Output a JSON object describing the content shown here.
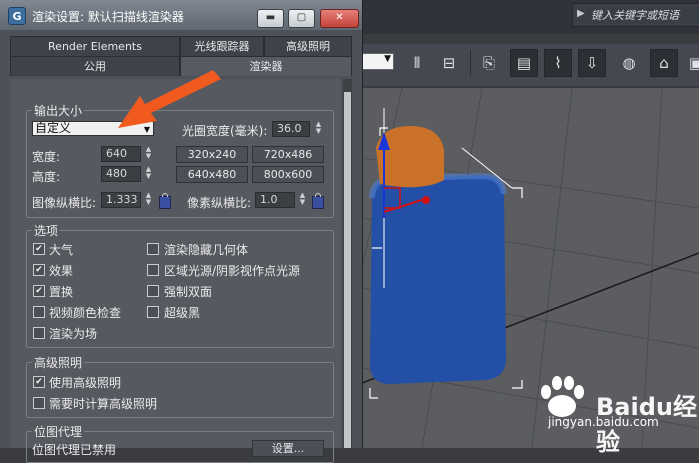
{
  "app": {
    "search_placeholder": "键入关键字或短语"
  },
  "dialog": {
    "title": "渲染设置: 默认扫描线渲染器",
    "tabs_row1": [
      "Render Elements",
      "光线跟踪器",
      "高级照明"
    ],
    "tabs_row2": [
      "公用",
      "渲染器"
    ],
    "output_size": {
      "title": "输出大小",
      "preset": "自定义",
      "aperture_label": "光圈宽度(毫米):",
      "aperture_value": "36.0",
      "width_label": "宽度:",
      "width_value": "640",
      "height_label": "高度:",
      "height_value": "480",
      "presets": [
        "320x240",
        "720x486",
        "640x480",
        "800x600"
      ],
      "image_aspect_label": "图像纵横比:",
      "image_aspect_value": "1.333",
      "pixel_aspect_label": "像素纵横比:",
      "pixel_aspect_value": "1.0"
    },
    "options": {
      "title": "选项",
      "left": [
        {
          "label": "大气",
          "checked": true
        },
        {
          "label": "效果",
          "checked": true
        },
        {
          "label": "置换",
          "checked": true
        },
        {
          "label": "视频颜色检查",
          "checked": false
        },
        {
          "label": "渲染为场",
          "checked": false
        }
      ],
      "right": [
        {
          "label": "渲染隐藏几何体",
          "checked": false
        },
        {
          "label": "区域光源/阴影视作点光源",
          "checked": false
        },
        {
          "label": "强制双面",
          "checked": false
        },
        {
          "label": "超级黑",
          "checked": false
        }
      ]
    },
    "advanced_lighting": {
      "title": "高级照明",
      "items": [
        {
          "label": "使用高级照明",
          "checked": true
        },
        {
          "label": "需要时计算高级照明",
          "checked": false
        }
      ]
    },
    "bitmap_proxy": {
      "title": "位图代理",
      "status": "位图代理已禁用",
      "settings_label": "设置..."
    }
  },
  "watermark": {
    "brand": "Baidu经验",
    "url": "jingyan.baidu.com"
  },
  "colors": {
    "annotation_arrow": "#f05a1e",
    "viewport_bg": "#5b5d60",
    "object_blue": "#2350a6",
    "object_orange": "#d17a2c"
  }
}
